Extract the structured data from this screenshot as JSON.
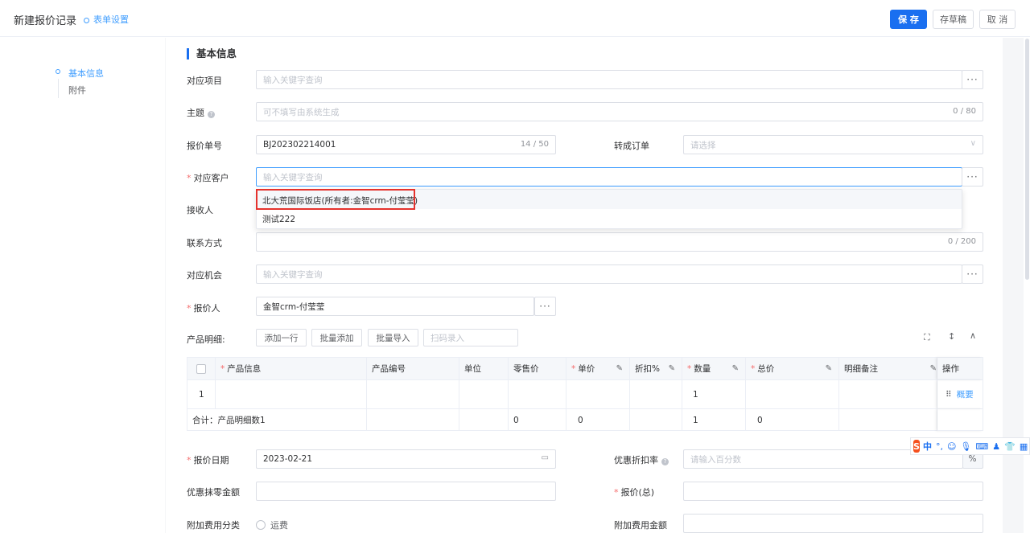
{
  "header": {
    "title": "新建报价记录",
    "form_settings": "表单设置",
    "save": "保 存",
    "draft": "存草稿",
    "cancel": "取 消"
  },
  "nav": {
    "items": [
      "基本信息",
      "附件"
    ]
  },
  "section_title": "基本信息",
  "fields": {
    "project": {
      "label": "对应项目",
      "placeholder": "输入关键字查询"
    },
    "subject": {
      "label": "主题",
      "placeholder": "可不填写由系统生成",
      "count": "0 / 80"
    },
    "quote_no": {
      "label": "报价单号",
      "value": "BJ202302214001",
      "count": "14 / 50"
    },
    "to_order": {
      "label": "转成订单",
      "placeholder": "请选择"
    },
    "customer": {
      "label": "对应客户",
      "placeholder": "输入关键字查询"
    },
    "receiver": {
      "label": "接收人"
    },
    "contact": {
      "label": "联系方式",
      "count": "0 / 200"
    },
    "opportunity": {
      "label": "对应机会",
      "placeholder": "输入关键字查询"
    },
    "quoter": {
      "label": "报价人",
      "value": "金智crm-付莹莹"
    },
    "quote_date": {
      "label": "报价日期",
      "value": "2023-02-21"
    },
    "discount_rate": {
      "label": "优惠折扣率",
      "placeholder": "请输入百分数",
      "unit": "%"
    },
    "round_off": {
      "label": "优惠抹零金额"
    },
    "total_quote": {
      "label": "报价(总)"
    },
    "extra_type": {
      "label": "附加费用分类",
      "option": "运费"
    },
    "extra_amount": {
      "label": "附加费用金额"
    }
  },
  "dropdown": {
    "options": [
      "北大荒国际饭店(所有者:金智crm-付莹莹)",
      "测试222"
    ]
  },
  "products": {
    "label": "产品明细:",
    "buttons": [
      "添加一行",
      "批量添加",
      "批量导入"
    ],
    "scan_placeholder": "扫码录入",
    "columns": [
      "产品信息",
      "产品编号",
      "单位",
      "零售价",
      "单价",
      "折扣%",
      "数量",
      "总价",
      "明细备注",
      "操作"
    ],
    "row": {
      "index": "1",
      "qty": "1",
      "action": "概要"
    },
    "summary": {
      "label": "合计：产品明细数1",
      "retail": "0",
      "price": "0",
      "qty": "1",
      "total": "0"
    }
  },
  "ime": {
    "logo": "S",
    "lang": "中"
  }
}
